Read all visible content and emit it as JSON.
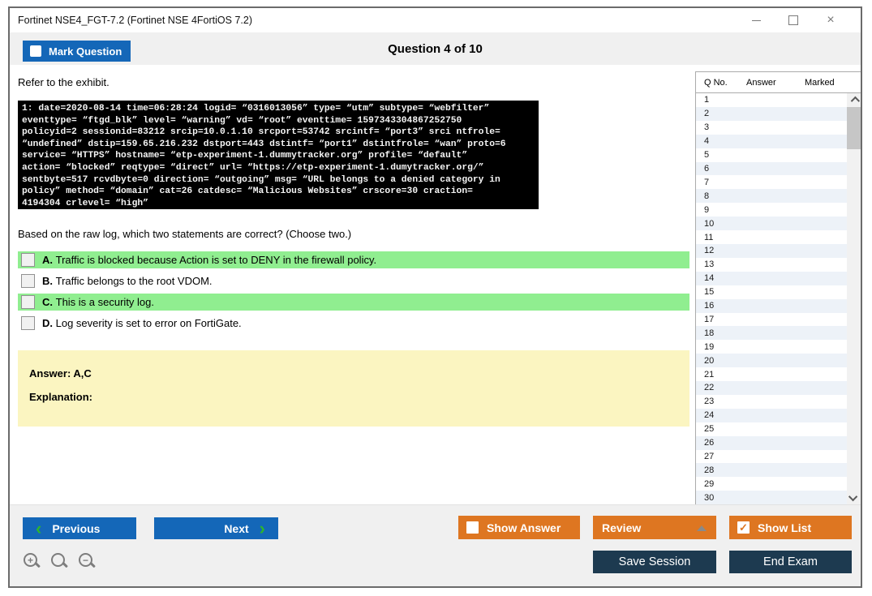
{
  "colors": {
    "blue": "#1467b8",
    "orange": "#de7621",
    "navy": "#1d3a50",
    "green": "#90ee90",
    "yellow": "#fbf5c1",
    "stripe": "#edf2f8",
    "band_gray": "#f0f0f0",
    "window_border": "#6b6b6b"
  },
  "window": {
    "title": "Fortinet NSE4_FGT-7.2 (Fortinet NSE 4FortiOS 7.2)"
  },
  "header": {
    "mark_question_label": "Mark Question",
    "question_counter": "Question 4 of 10"
  },
  "question": {
    "exhibit_label": "Refer to the exhibit.",
    "log_lines": [
      "1: date=2020-08-14 time=06:28:24 logid= “0316013056” type= “utm” subtype= “webfilter”",
      "eventtype= “ftgd_blk” level= “warning” vd= “root” eventtime= 1597343304867252750",
      "policyid=2 sessionid=83212 srcip=10.0.1.10 srcport=53742 srcintf= “port3” srci ntfrole=",
      "“undefined” dstip=159.65.216.232 dstport=443 dstintf= “port1” dstintfrole= “wan” proto=6",
      "service= “HTTPS” hostname= “etp-experiment-1.dummytracker.org” profile= “default”",
      "action= “blocked” reqtype= “direct” url= “https://etp-experiment-1.dumytracker.org/”",
      "sentbyte=517 rcvdbyte=0 direction= “outgoing” msg= “URL belongs to a denied category in",
      "policy” method= “domain” cat=26 catdesc= “Malicious Websites” crscore=30 craction=",
      "4194304 crlevel= “high”"
    ],
    "prompt": "Based on the raw log, which two statements are correct? (Choose two.)",
    "options": [
      {
        "letter": "A.",
        "text": "Traffic is blocked because Action is set to DENY in the firewall policy.",
        "highlighted": true
      },
      {
        "letter": "B.",
        "text": "Traffic belongs to the root VDOM.",
        "highlighted": false
      },
      {
        "letter": "C.",
        "text": "This is a security log.",
        "highlighted": true
      },
      {
        "letter": "D.",
        "text": "Log severity is set to error on FortiGate.",
        "highlighted": false
      }
    ],
    "answer_label": "Answer: A,C",
    "explanation_label": "Explanation:"
  },
  "question_list": {
    "columns": [
      "Q No.",
      "Answer",
      "Marked"
    ],
    "rows": [
      "1",
      "2",
      "3",
      "4",
      "5",
      "6",
      "7",
      "8",
      "9",
      "10",
      "11",
      "12",
      "13",
      "14",
      "15",
      "16",
      "17",
      "18",
      "19",
      "20",
      "21",
      "22",
      "23",
      "24",
      "25",
      "26",
      "27",
      "28",
      "29",
      "30"
    ]
  },
  "footer": {
    "previous_label": "Previous",
    "next_label": "Next",
    "show_answer_label": "Show Answer",
    "review_label": "Review",
    "show_list_label": "Show List",
    "save_session_label": "Save Session",
    "end_exam_label": "End Exam",
    "prev_chevron": "‹",
    "next_chevron": "›",
    "show_list_check": "✓",
    "zoom_in_sign": "+",
    "zoom_out_sign": "−"
  }
}
